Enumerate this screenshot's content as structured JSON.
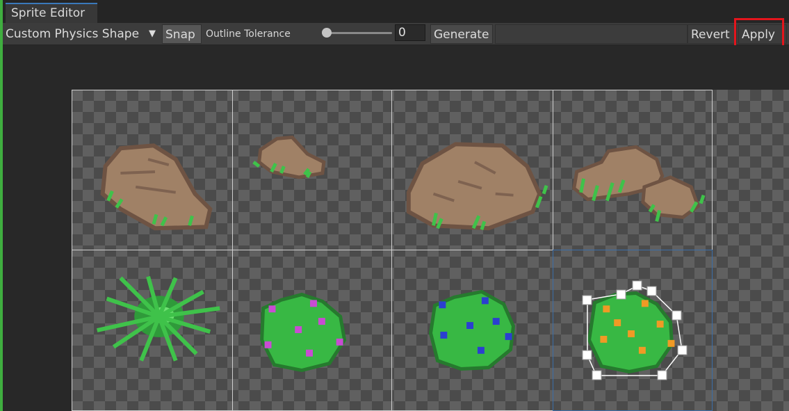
{
  "window": {
    "tab_title": "Sprite Editor"
  },
  "toolbar": {
    "mode_dropdown": "Custom Physics Shape",
    "snap_label": "Snap",
    "outline_tolerance_label": "Outline Tolerance",
    "outline_tolerance_value": "0",
    "outline_tolerance_slider": 0,
    "generate_label": "Generate",
    "revert_label": "Revert",
    "apply_label": "Apply"
  },
  "icons": {
    "dropdown": "chevron-down-icon"
  },
  "colors": {
    "highlight": "#e3151c",
    "selection": "#3b6ea8",
    "rock": "#a08166",
    "grass": "#3fc24a",
    "flower_magenta": "#c84cd2",
    "flower_blue": "#2b3fd0",
    "flower_orange": "#f09a25"
  },
  "sprites": [
    {
      "name": "rock-1",
      "kind": "rock"
    },
    {
      "name": "rock-2",
      "kind": "rock"
    },
    {
      "name": "rock-3",
      "kind": "rock"
    },
    {
      "name": "rock-4",
      "kind": "rock"
    },
    {
      "name": "grass-tuft",
      "kind": "plant"
    },
    {
      "name": "bush-magenta",
      "kind": "plant"
    },
    {
      "name": "bush-blue",
      "kind": "plant"
    },
    {
      "name": "bush-orange",
      "kind": "plant",
      "selected": true
    }
  ]
}
